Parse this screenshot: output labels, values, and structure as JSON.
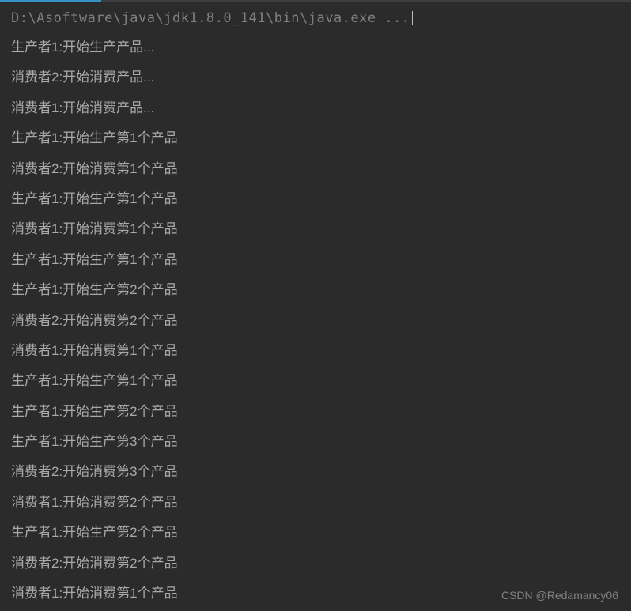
{
  "header": {
    "command": "D:\\Asoftware\\java\\jdk1.8.0_141\\bin\\java.exe ..."
  },
  "output": [
    "生产者1:开始生产产品...",
    "消费者2:开始消费产品...",
    "消费者1:开始消费产品...",
    "生产者1:开始生产第1个产品",
    "消费者2:开始消费第1个产品",
    "生产者1:开始生产第1个产品",
    "消费者1:开始消费第1个产品",
    "生产者1:开始生产第1个产品",
    "生产者1:开始生产第2个产品",
    "消费者2:开始消费第2个产品",
    "消费者1:开始消费第1个产品",
    "生产者1:开始生产第1个产品",
    "生产者1:开始生产第2个产品",
    "生产者1:开始生产第3个产品",
    "消费者2:开始消费第3个产品",
    "消费者1:开始消费第2个产品",
    "生产者1:开始生产第2个产品",
    "消费者2:开始消费第2个产品",
    "消费者1:开始消费第1个产品"
  ],
  "watermark": "CSDN @Redamancy06"
}
